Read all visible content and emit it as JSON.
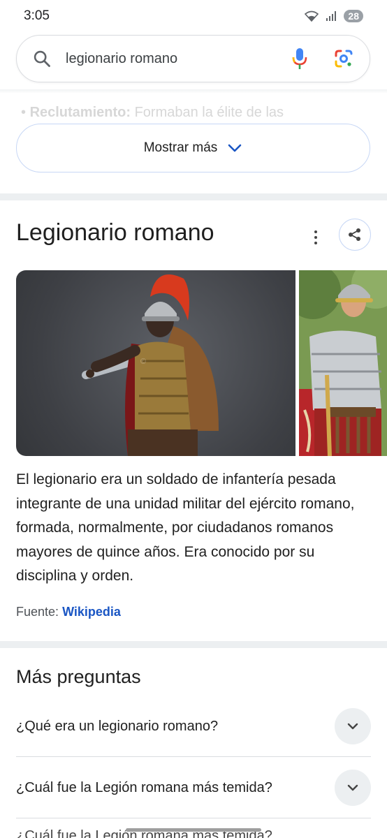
{
  "status": {
    "time": "3:05",
    "battery": "28"
  },
  "search": {
    "query": "legionario romano"
  },
  "faded_bullet": {
    "label": "Reclutamiento:",
    "text": " Formaban la élite de las"
  },
  "show_more": {
    "label": "Mostrar más"
  },
  "knowledge_panel": {
    "title": "Legionario romano",
    "description": "El legionario era un soldado de infantería pesada integrante de una unidad militar del ejército romano, formada, normalmente, por ciudadanos romanos mayores de quince años. Era conocido por su disciplina y orden.",
    "source_label": "Fuente:",
    "source_link": "Wikipedia"
  },
  "paa": {
    "title": "Más preguntas",
    "questions": [
      "¿Qué era un legionario romano?",
      "¿Cuál fue la Legión romana más temida?",
      "¿Cuál fue la Legión romana más temida?"
    ]
  }
}
